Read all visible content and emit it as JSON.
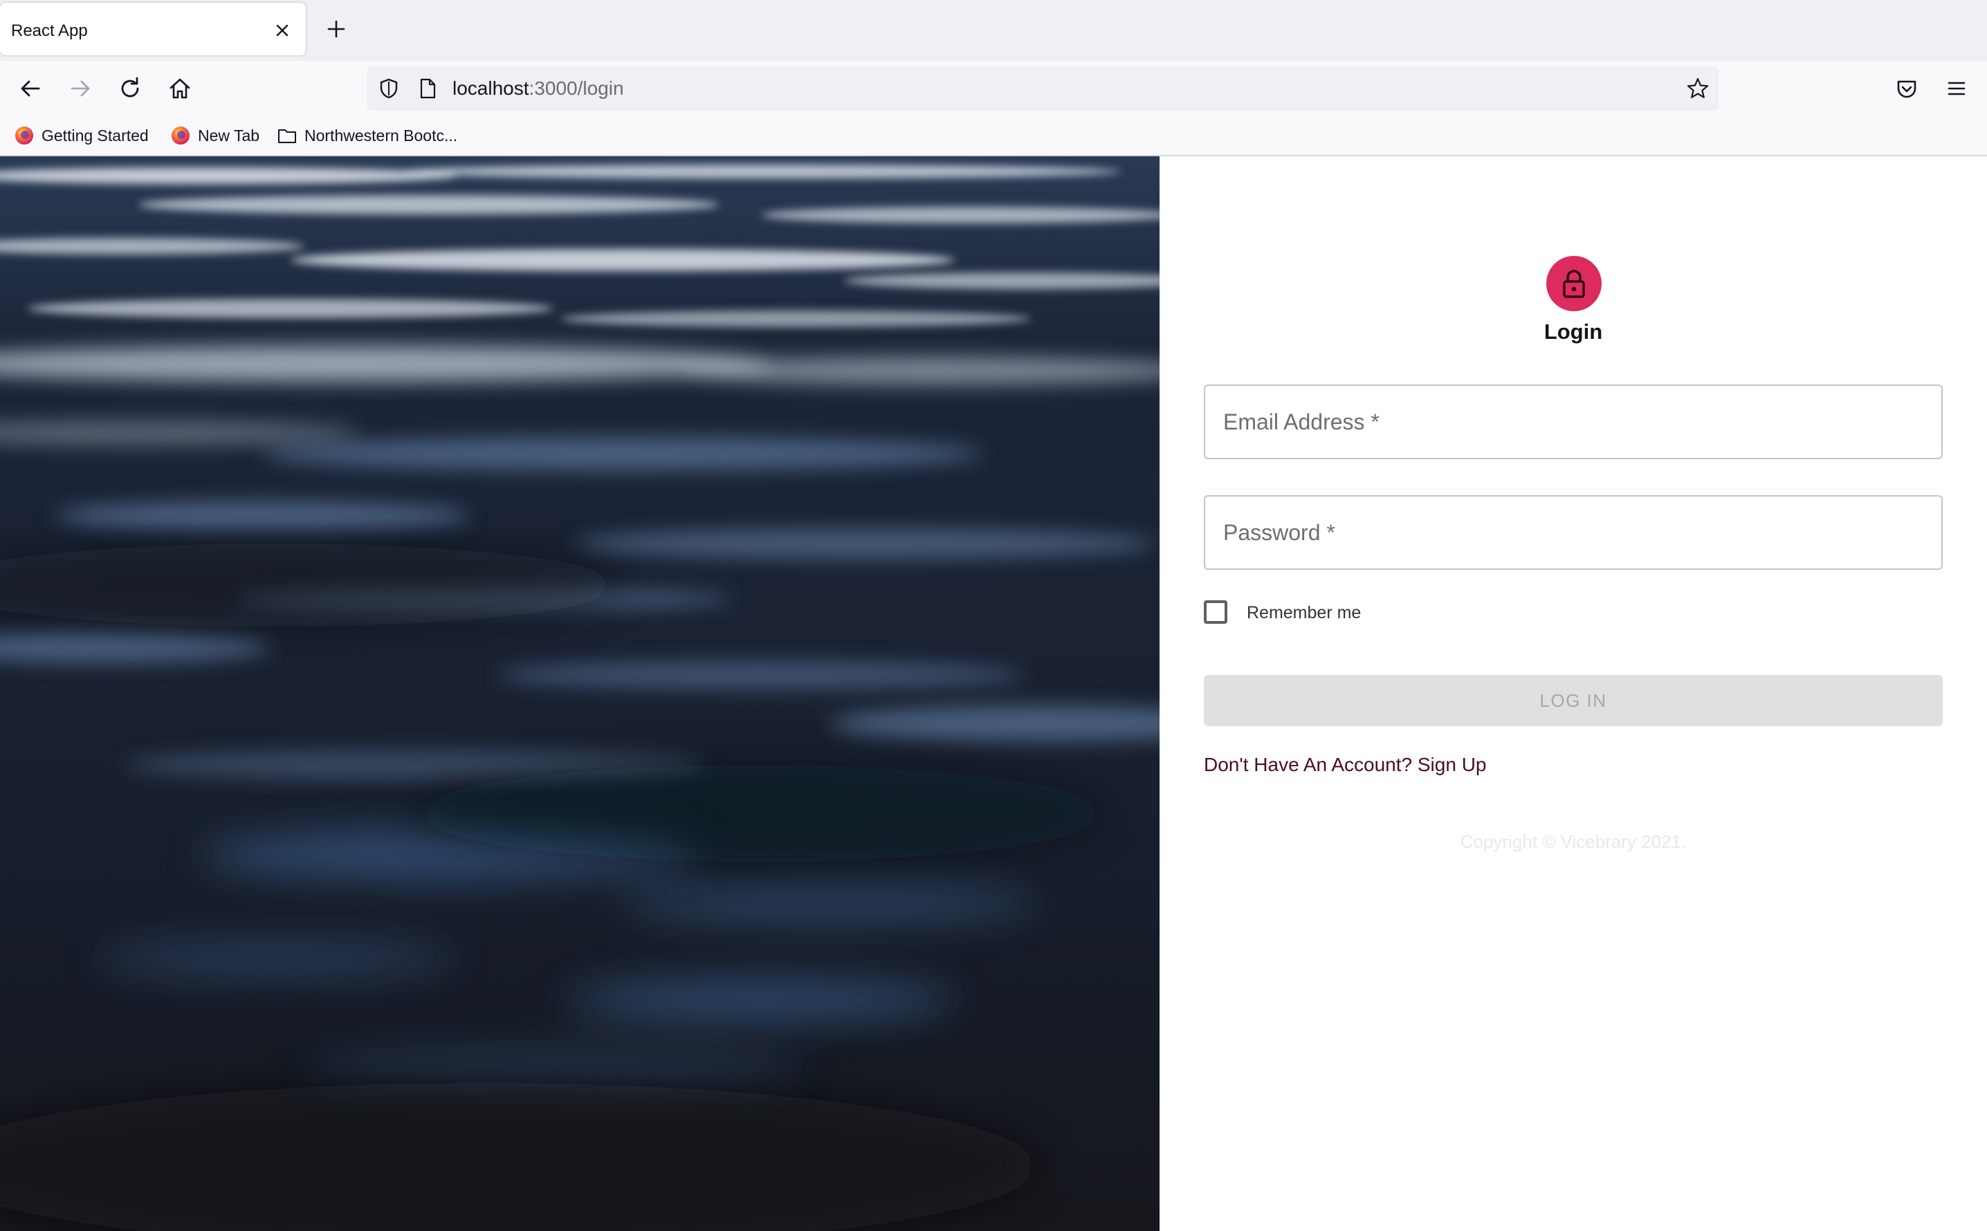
{
  "browser": {
    "tab": {
      "title": "React App"
    },
    "url": {
      "host": "localhost",
      "path": ":3000/login"
    },
    "bookmarks": [
      {
        "label": "Getting Started",
        "icon": "firefox-logo-icon"
      },
      {
        "label": "New Tab",
        "icon": "firefox-logo-icon"
      },
      {
        "label": "Northwestern Bootc...",
        "icon": "folder-icon"
      }
    ]
  },
  "hero": {
    "image": "dark-blue-water-ripples"
  },
  "login": {
    "icon": "lock-icon",
    "accent_color": "#dc2b5c",
    "title": "Login",
    "email": {
      "placeholder": "Email Address *",
      "value": ""
    },
    "password": {
      "placeholder": "Password *",
      "value": ""
    },
    "remember": {
      "label": "Remember me",
      "checked": false
    },
    "submit_label": "LOG IN",
    "signup_label": "Don't Have An Account? Sign Up",
    "copyright": "Copyright © Vicebrary 2021."
  }
}
